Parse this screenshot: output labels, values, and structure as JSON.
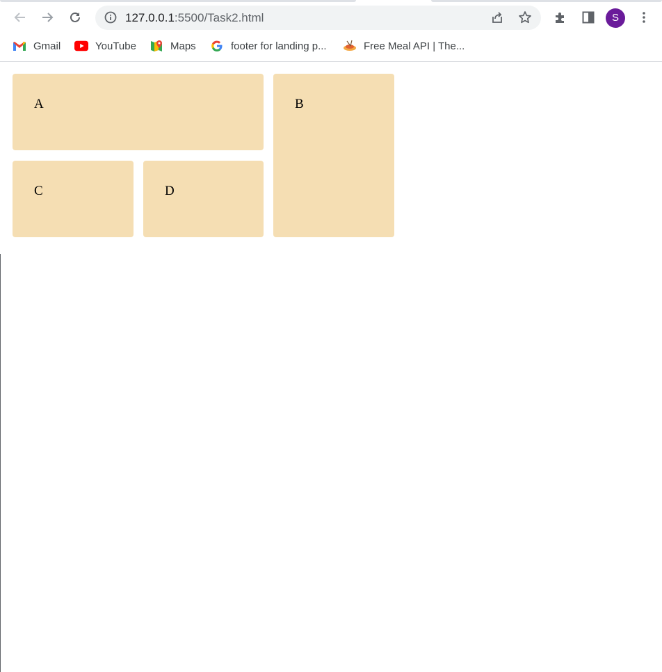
{
  "browser": {
    "url_host": "127.0.0.1",
    "url_rest": ":5500/Task2.html",
    "profile_initial": "S",
    "toolbar_icons": [
      "back-arrow-icon",
      "forward-arrow-icon",
      "reload-icon",
      "info-icon",
      "share-icon",
      "star-icon",
      "extensions-icon",
      "side-panel-icon",
      "more-vert-icon"
    ]
  },
  "bookmarks": [
    {
      "label": "Gmail",
      "icon": "gmail-icon"
    },
    {
      "label": "YouTube",
      "icon": "youtube-icon"
    },
    {
      "label": "Maps",
      "icon": "maps-icon"
    },
    {
      "label": "footer for landing p...",
      "icon": "google-icon"
    },
    {
      "label": "Free Meal API | The...",
      "icon": "meal-icon"
    }
  ],
  "page": {
    "boxes": [
      {
        "label": "A"
      },
      {
        "label": "B"
      },
      {
        "label": "C"
      },
      {
        "label": "D"
      }
    ],
    "box_color": "#f5deb3"
  }
}
